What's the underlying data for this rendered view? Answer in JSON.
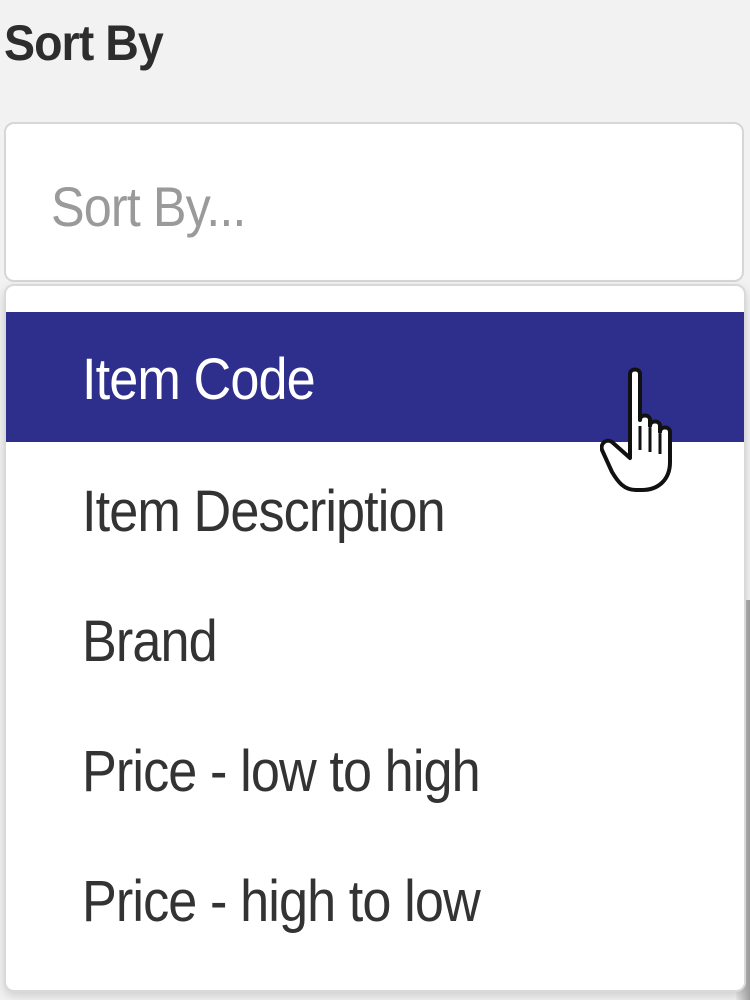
{
  "sort": {
    "label": "Sort By",
    "placeholder": "Sort By...",
    "options": [
      {
        "label": "Item Code",
        "selected": true
      },
      {
        "label": "Item Description",
        "selected": false
      },
      {
        "label": "Brand",
        "selected": false
      },
      {
        "label": "Price - low to high",
        "selected": false
      },
      {
        "label": "Price - high to low",
        "selected": false
      }
    ]
  },
  "colors": {
    "highlight": "#2e2e8c",
    "text": "#333333",
    "placeholder": "#9a9a9a"
  },
  "cursor_icon": "hand-pointer-icon"
}
